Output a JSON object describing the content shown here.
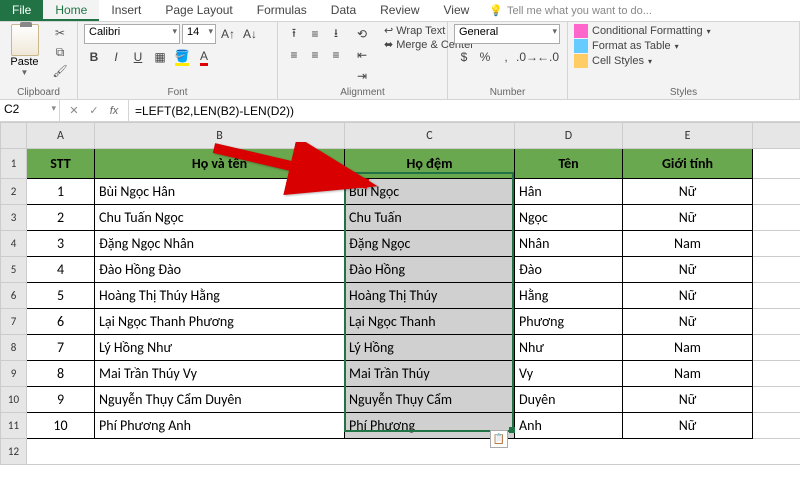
{
  "tabs": {
    "file": "File",
    "home": "Home",
    "insert": "Insert",
    "pagelayout": "Page Layout",
    "formulas": "Formulas",
    "data": "Data",
    "review": "Review",
    "view": "View"
  },
  "tellme": "Tell me what you want to do...",
  "ribbon": {
    "clipboard": {
      "paste": "Paste",
      "label": "Clipboard"
    },
    "font": {
      "name": "Calibri",
      "size": "14",
      "label": "Font"
    },
    "align": {
      "wrap": "Wrap Text",
      "merge": "Merge & Center",
      "label": "Alignment"
    },
    "number": {
      "format": "General",
      "label": "Number"
    },
    "styles": {
      "cond": "Conditional Formatting",
      "table": "Format as Table",
      "cell": "Cell Styles",
      "label": "Styles"
    }
  },
  "namebox": "C2",
  "formula": "=LEFT(B2,LEN(B2)-LEN(D2))",
  "columns": [
    "A",
    "B",
    "C",
    "D",
    "E"
  ],
  "headers": {
    "stt": "STT",
    "hoten": "Họ và tên",
    "hodem": "Họ đệm",
    "ten": "Tên",
    "gioitinh": "Giới tính"
  },
  "rows": [
    {
      "n": "2",
      "stt": "1",
      "hoten": "Bùi Ngọc Hân",
      "hodem": "Bùi Ngọc",
      "ten": "Hân",
      "gt": "Nữ"
    },
    {
      "n": "3",
      "stt": "2",
      "hoten": "Chu Tuấn Ngọc",
      "hodem": "Chu Tuấn",
      "ten": "Ngọc",
      "gt": "Nữ"
    },
    {
      "n": "4",
      "stt": "3",
      "hoten": "Đặng Ngọc Nhân",
      "hodem": "Đặng Ngọc",
      "ten": "Nhân",
      "gt": "Nam"
    },
    {
      "n": "5",
      "stt": "4",
      "hoten": "Đào Hồng Đào",
      "hodem": "Đào Hồng",
      "ten": "Đào",
      "gt": "Nữ"
    },
    {
      "n": "6",
      "stt": "5",
      "hoten": "Hoàng Thị Thúy Hằng",
      "hodem": "Hoàng Thị Thúy",
      "ten": "Hằng",
      "gt": "Nữ"
    },
    {
      "n": "7",
      "stt": "6",
      "hoten": "Lại Ngọc Thanh Phương",
      "hodem": "Lại Ngọc Thanh",
      "ten": "Phương",
      "gt": "Nữ"
    },
    {
      "n": "8",
      "stt": "7",
      "hoten": "Lý Hồng Như",
      "hodem": "Lý Hồng",
      "ten": "Như",
      "gt": "Nam"
    },
    {
      "n": "9",
      "stt": "8",
      "hoten": "Mai Trần Thúy Vy",
      "hodem": "Mai Trần Thúy",
      "ten": "Vy",
      "gt": "Nam"
    },
    {
      "n": "10",
      "stt": "9",
      "hoten": "Nguyễn Thụy Cẩm Duyên",
      "hodem": "Nguyễn Thụy Cẩm",
      "ten": "Duyên",
      "gt": "Nữ"
    },
    {
      "n": "11",
      "stt": "10",
      "hoten": "Phí Phương Anh",
      "hodem": "Phí Phương",
      "ten": "Anh",
      "gt": "Nữ"
    }
  ]
}
